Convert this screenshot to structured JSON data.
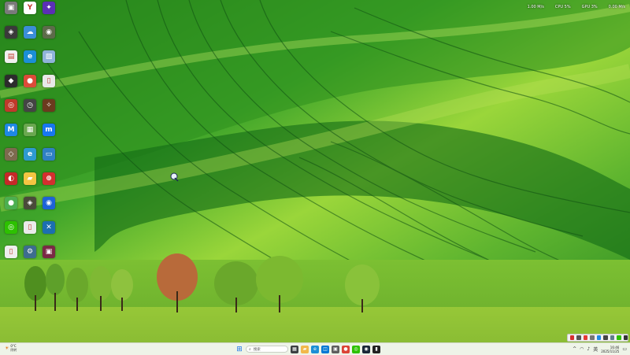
{
  "desktop": {
    "icons": [
      {
        "label": "",
        "icon": "folder-icon",
        "color": "#7a7a7a",
        "glyph": "▣"
      },
      {
        "label": "",
        "icon": "yandex-icon",
        "color": "#ffffff",
        "glyph": "Y"
      },
      {
        "label": "",
        "icon": "purple-app-icon",
        "color": "#5b2fb5",
        "glyph": "✦"
      },
      {
        "label": "",
        "icon": "game-icon",
        "color": "#3a3a3a",
        "glyph": "◈"
      },
      {
        "label": "",
        "icon": "cloud-app-icon",
        "color": "#3b8ed8",
        "glyph": "☁"
      },
      {
        "label": "",
        "icon": "game-icon",
        "color": "#5d6b4a",
        "glyph": "◉"
      },
      {
        "label": "",
        "icon": "document-icon",
        "color": "#f0f0f0",
        "glyph": "▤"
      },
      {
        "label": "",
        "icon": "edge-icon",
        "color": "#1b8fd6",
        "glyph": "e"
      },
      {
        "label": "",
        "icon": "image-icon",
        "color": "#8fb3d9",
        "glyph": "▧"
      },
      {
        "label": "",
        "icon": "game-icon",
        "color": "#2c2c2c",
        "glyph": "◆"
      },
      {
        "label": "",
        "icon": "chrome-icon",
        "color": "#dd4b39",
        "glyph": "●"
      },
      {
        "label": "",
        "icon": "document-icon",
        "color": "#e8e8e8",
        "glyph": "▯"
      },
      {
        "label": "",
        "icon": "target-icon",
        "color": "#c0392b",
        "glyph": "◎"
      },
      {
        "label": "",
        "icon": "clock-icon",
        "color": "#444444",
        "glyph": "◷"
      },
      {
        "label": "",
        "icon": "game-icon",
        "color": "#6b3a1e",
        "glyph": "✧"
      },
      {
        "label": "",
        "icon": "app-m-icon",
        "color": "#1e88e5",
        "glyph": "M"
      },
      {
        "label": "",
        "icon": "image-icon",
        "color": "#6aa84f",
        "glyph": "▦"
      },
      {
        "label": "",
        "icon": "messenger-icon",
        "color": "#1877f2",
        "glyph": "m"
      },
      {
        "label": "",
        "icon": "game-icon",
        "color": "#7d6a4e",
        "glyph": "◇"
      },
      {
        "label": "",
        "icon": "edge-icon",
        "color": "#2e9ad0",
        "glyph": "e"
      },
      {
        "label": "",
        "icon": "monitor-icon",
        "color": "#2f80c4",
        "glyph": "▭"
      },
      {
        "label": "",
        "icon": "red-app-icon",
        "color": "#c62828",
        "glyph": "◐"
      },
      {
        "label": "",
        "icon": "folder-icon",
        "color": "#f4c542",
        "glyph": "▰"
      },
      {
        "label": "",
        "icon": "target-icon",
        "color": "#d32f2f",
        "glyph": "⊕"
      },
      {
        "label": "",
        "icon": "chrome-icon",
        "color": "#4caf50",
        "glyph": "●"
      },
      {
        "label": "",
        "icon": "game-icon",
        "color": "#4a4a3a",
        "glyph": "◈"
      },
      {
        "label": "",
        "icon": "blue-circle-icon",
        "color": "#1e63d8",
        "glyph": "◉"
      },
      {
        "label": "",
        "icon": "wechat-icon",
        "color": "#2dc100",
        "glyph": "◎"
      },
      {
        "label": "",
        "icon": "document-icon",
        "color": "#eaeaea",
        "glyph": "▯"
      },
      {
        "label": "",
        "icon": "tool-icon",
        "color": "#1c6fb0",
        "glyph": "✕"
      },
      {
        "label": "",
        "icon": "document-icon",
        "color": "#eeeeee",
        "glyph": "▯"
      },
      {
        "label": "",
        "icon": "settings-icon",
        "color": "#3d6d8f",
        "glyph": "⚙"
      },
      {
        "label": "",
        "icon": "app-icon",
        "color": "#7a2a45",
        "glyph": "▣"
      }
    ]
  },
  "net_monitor": {
    "items": [
      "1.00 M/s",
      "CPU 5%",
      "GPU 3%",
      "0.00 M/s"
    ]
  },
  "taskbar": {
    "weather": {
      "temp": "0°C",
      "condition": "阴转"
    },
    "search_placeholder": "搜索",
    "apps": [
      {
        "icon": "windows-start-icon",
        "color": "#1a73e8",
        "glyph": "⊞"
      },
      {
        "icon": "files-icon",
        "color": "#3c4043",
        "glyph": "▦"
      },
      {
        "icon": "explorer-icon",
        "color": "#f2b84b",
        "glyph": "▰"
      },
      {
        "icon": "edge-icon",
        "color": "#1b8fd6",
        "glyph": "e"
      },
      {
        "icon": "store-icon",
        "color": "#0078d4",
        "glyph": "◫"
      },
      {
        "icon": "app-icon",
        "color": "#5e5e5e",
        "glyph": "▣"
      },
      {
        "icon": "chrome-icon",
        "color": "#db4437",
        "glyph": "●"
      },
      {
        "icon": "wechat-icon",
        "color": "#2dc100",
        "glyph": "◎"
      },
      {
        "icon": "steam-icon",
        "color": "#1b2838",
        "glyph": "◉"
      },
      {
        "icon": "terminal-icon",
        "color": "#222222",
        "glyph": "▮"
      }
    ],
    "tray": {
      "chevron": "^",
      "lang": "英",
      "clock_time": "16:46",
      "clock_date": "2025/11/25"
    }
  }
}
